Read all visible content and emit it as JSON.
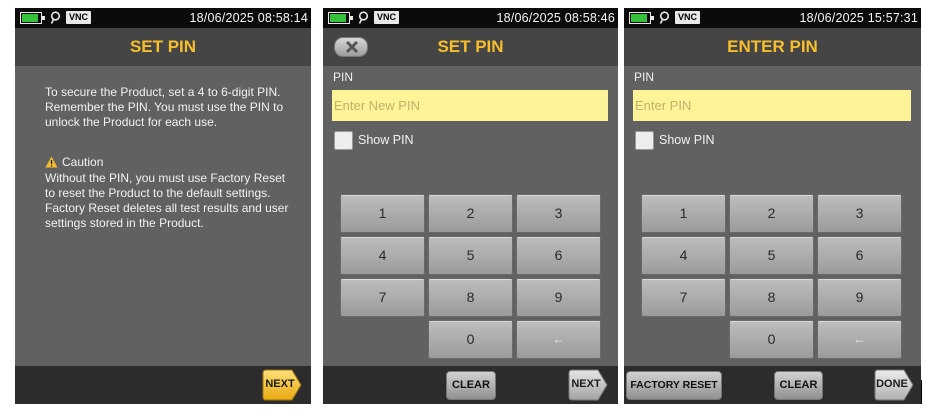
{
  "status": {
    "vnc_label": "VNC",
    "wifi_icon": "location-pin-icon",
    "battery_color": "#35c23a"
  },
  "screens": [
    {
      "clock": "18/06/2025 08:58:14",
      "title": "SET PIN",
      "body": "To secure the Product, set a 4 to 6-digit PIN. Remember the PIN. You must use the PIN to unlock the Product for each use.",
      "caution_title": "Caution",
      "caution_body": "Without the PIN, you must use Factory Reset to reset the Product to the default settings. Factory Reset deletes all test results and user settings stored in the Product.",
      "next_label": "NEXT"
    },
    {
      "clock": "18/06/2025 08:58:46",
      "title": "SET PIN",
      "pin_label": "PIN",
      "pin_placeholder": "Enter New PIN",
      "show_pin_label": "Show PIN",
      "keys": [
        "1",
        "2",
        "3",
        "4",
        "5",
        "6",
        "7",
        "8",
        "9",
        "0",
        "←"
      ],
      "clear_label": "CLEAR",
      "next_label": "NEXT"
    },
    {
      "clock": "18/06/2025 15:57:31",
      "title": "ENTER PIN",
      "pin_label": "PIN",
      "pin_placeholder": "Enter PIN",
      "show_pin_label": "Show PIN",
      "keys": [
        "1",
        "2",
        "3",
        "4",
        "5",
        "6",
        "7",
        "8",
        "9",
        "0",
        "←"
      ],
      "factory_reset_label": "FACTORY RESET",
      "clear_label": "CLEAR",
      "done_label": "DONE"
    }
  ],
  "colors": {
    "title": "#f6be2c",
    "input_bg": "#fdf49a",
    "next_button": "#f3b81f",
    "done_button": "#d9d9d9"
  }
}
